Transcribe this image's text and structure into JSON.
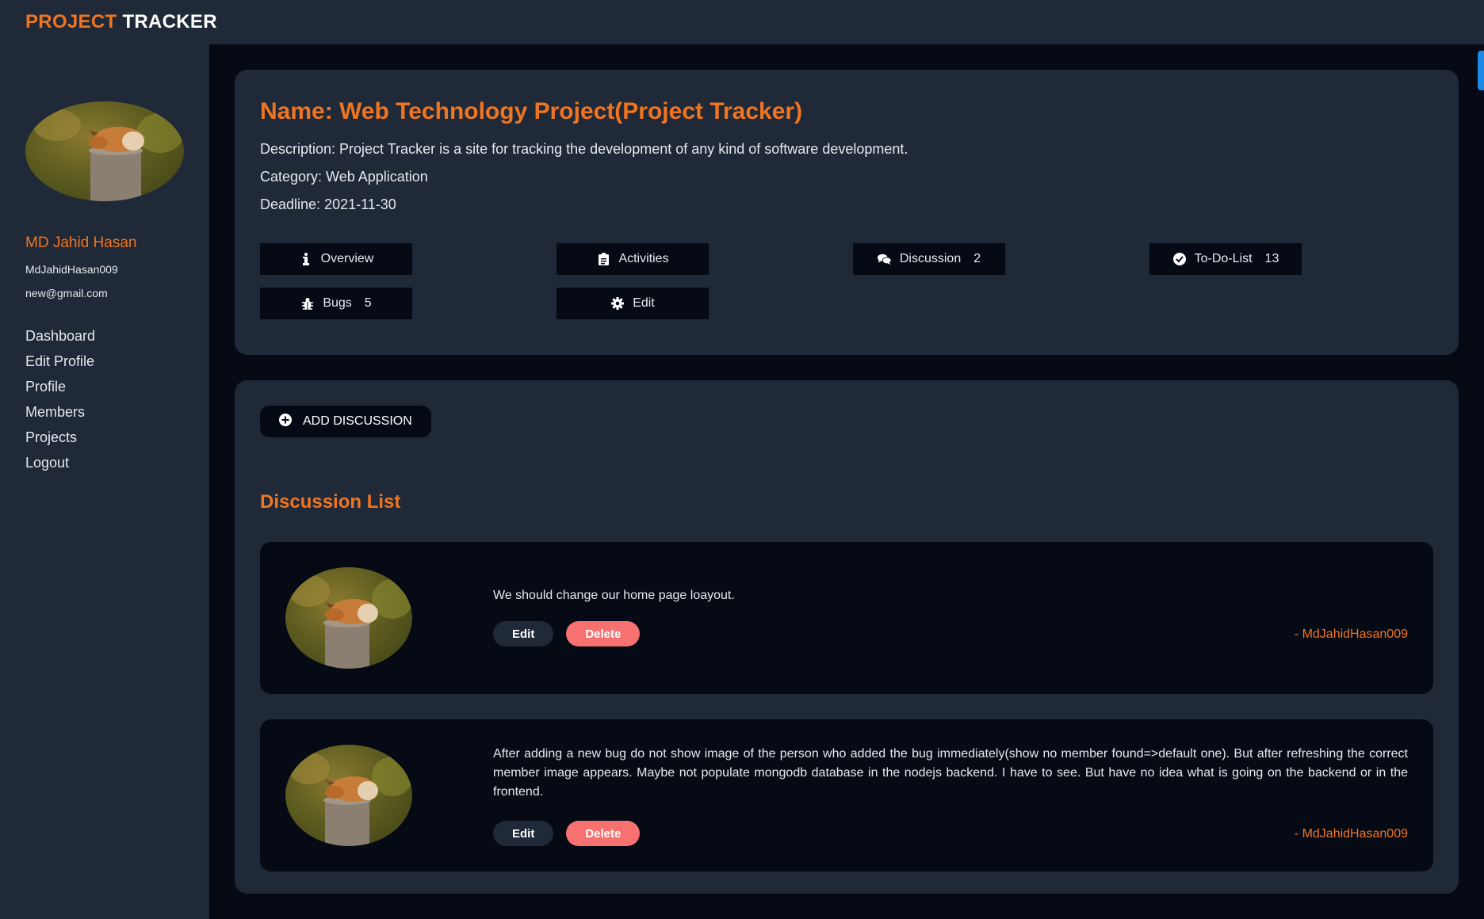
{
  "brand": {
    "part1": "PROJECT",
    "part2": "TRACKER"
  },
  "user": {
    "name": "MD Jahid Hasan",
    "handle": "MdJahidHasan009",
    "email": "new@gmail.com"
  },
  "nav": [
    "Dashboard",
    "Edit Profile",
    "Profile",
    "Members",
    "Projects",
    "Logout"
  ],
  "project": {
    "title": "Name: Web Technology Project(Project Tracker)",
    "description": "Description: Project Tracker is a site for tracking the development of any kind of software development.",
    "category": "Category: Web Application",
    "deadline": "Deadline: 2021-11-30"
  },
  "tabs": [
    {
      "label": "Overview",
      "icon": "info-icon",
      "count": ""
    },
    {
      "label": "Activities",
      "icon": "clipboard-icon",
      "count": ""
    },
    {
      "label": "Discussion",
      "icon": "comments-icon",
      "count": "2"
    },
    {
      "label": "To-Do-List",
      "icon": "check-circle-icon",
      "count": "13"
    },
    {
      "label": "Bugs",
      "icon": "bug-icon",
      "count": "5"
    },
    {
      "label": "Edit",
      "icon": "gear-icon",
      "count": ""
    }
  ],
  "add_discussion_label": "ADD DISCUSSION",
  "discussion_list_title": "Discussion List",
  "discussions": [
    {
      "text": "We should change our home page loayout.",
      "author": "- MdJahidHasan009",
      "edit_label": "Edit",
      "delete_label": "Delete"
    },
    {
      "text": "After adding a new bug do not show image of the person who added the bug immediately(show no member found=>default one). But after refreshing the correct member image appears. Maybe not populate mongodb database in the nodejs backend. I have to see. But have no idea what is going on the backend or in the frontend.",
      "author": "- MdJahidHasan009",
      "edit_label": "Edit",
      "delete_label": "Delete"
    }
  ],
  "colors": {
    "accent": "#f07522",
    "panel": "#1f2937",
    "background": "#050a14",
    "delete": "#f87171",
    "scroll": "#1e88e5"
  }
}
